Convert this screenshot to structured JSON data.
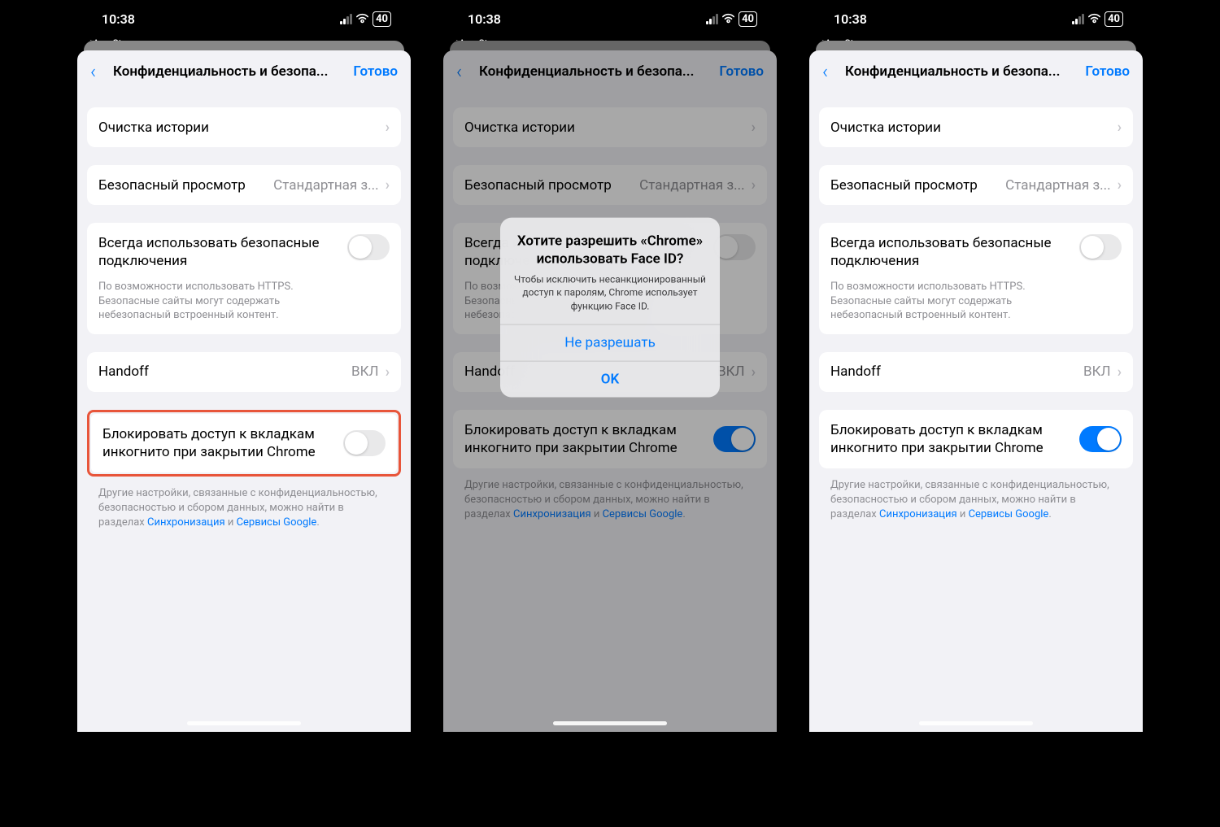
{
  "status": {
    "time": "10:38",
    "back_app": "App Store",
    "battery": "40"
  },
  "nav": {
    "title": "Конфиденциальность и безопа...",
    "done": "Готово"
  },
  "rows": {
    "clear_history": "Очистка истории",
    "safe_browsing_label": "Безопасный просмотр",
    "safe_browsing_value": "Стандартная з...",
    "always_https_label": "Всегда использовать безопасные подключения",
    "always_https_desc": "По возможности использовать HTTPS. Безопасные сайты могут содержать небезопасный встроенный контент.",
    "handoff_label": "Handoff",
    "handoff_value": "ВКЛ",
    "lock_incognito_label": "Блокировать доступ к вкладкам инкогнито при закрытии Chrome"
  },
  "footer": {
    "text_a": "Другие настройки, связанные с конфиденциальностью, безопасностью и сбором данных, можно найти в разделах ",
    "link1": "Синхронизация",
    "text_b": " и ",
    "link2": "Сервисы Google",
    "text_c": "."
  },
  "alert": {
    "title": "Хотите разрешить «Chrome» использовать Face ID?",
    "message": "Чтобы исключить несанкционированный доступ к паролям, Chrome использует функцию Face ID.",
    "deny": "Не разрешать",
    "ok": "OK"
  }
}
